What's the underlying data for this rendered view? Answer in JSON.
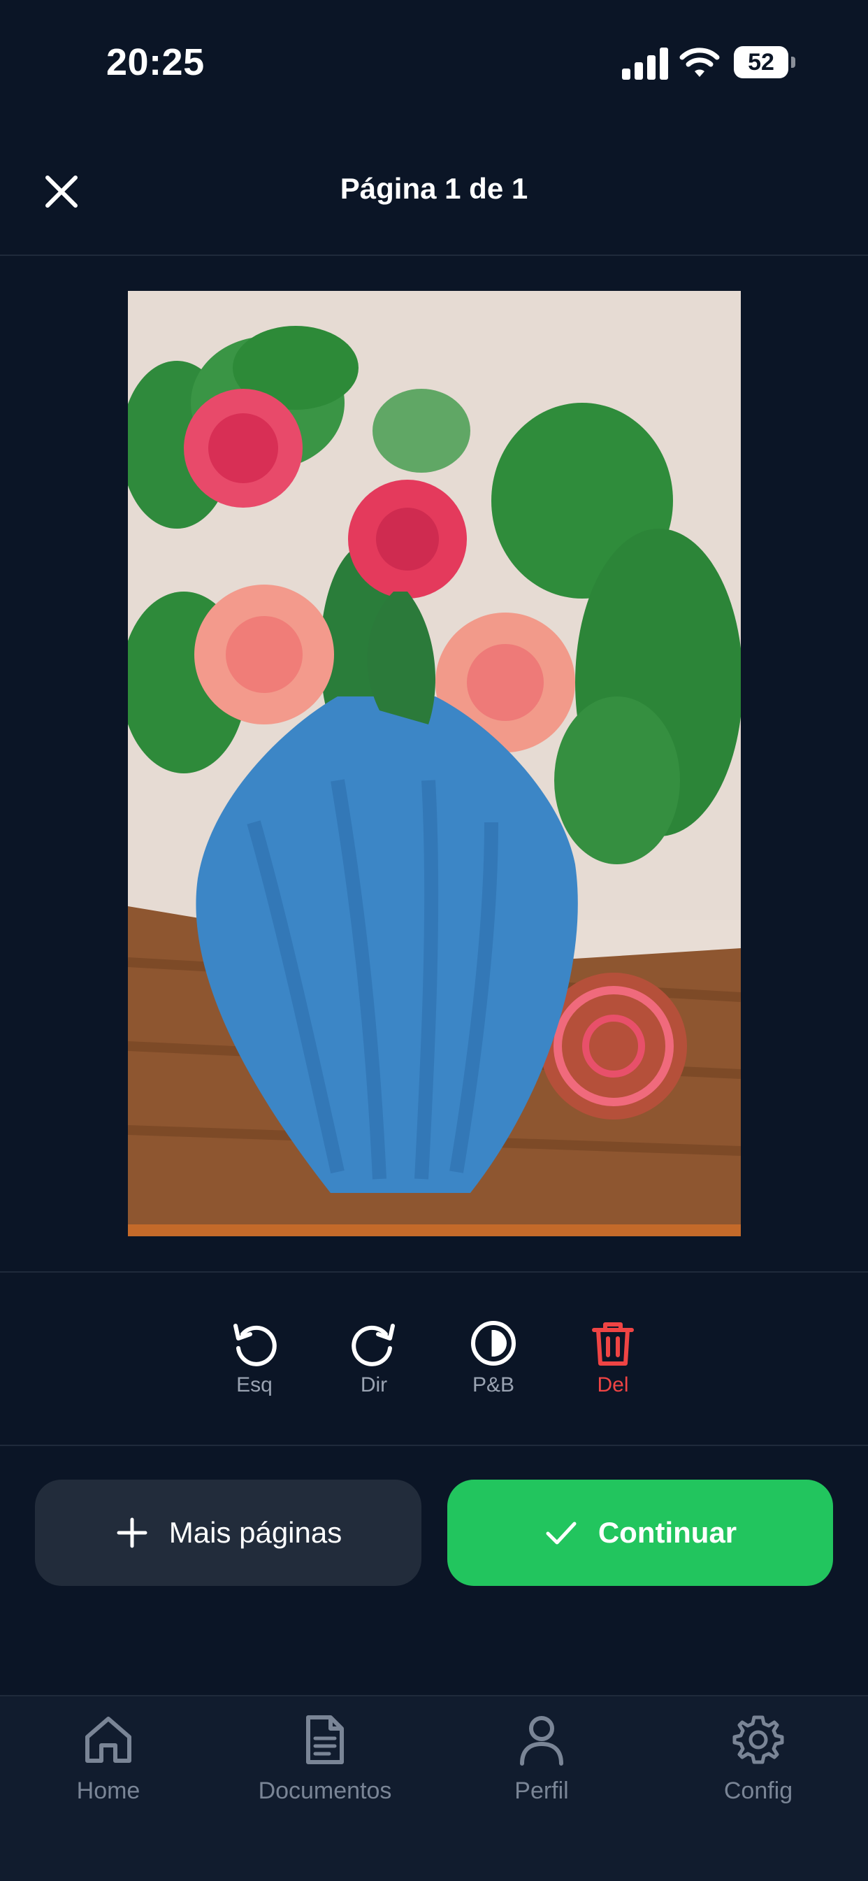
{
  "status_bar": {
    "time": "20:25",
    "battery_level": "52"
  },
  "header": {
    "title": "Página 1 de 1"
  },
  "preview": {
    "pages": 1
  },
  "edit_tools": [
    {
      "label": "Esq",
      "icon": "rotate-left-icon"
    },
    {
      "label": "Dir",
      "icon": "rotate-right-icon"
    },
    {
      "label": "P&B",
      "icon": "contrast-icon"
    },
    {
      "label": "Del",
      "icon": "trash-icon"
    }
  ],
  "actions": {
    "more_pages_label": "Mais páginas",
    "continue_label": "Continuar"
  },
  "bottom_nav": [
    {
      "label": "Home",
      "icon": "home-icon"
    },
    {
      "label": "Documentos",
      "icon": "document-icon"
    },
    {
      "label": "Perfil",
      "icon": "user-icon"
    },
    {
      "label": "Config",
      "icon": "gear-icon"
    }
  ],
  "colors": {
    "background": "#0b1526",
    "accent_green": "#22c55e",
    "danger_red": "#ef4444",
    "secondary_button": "#222c3b",
    "muted_text": "#7a8596"
  }
}
